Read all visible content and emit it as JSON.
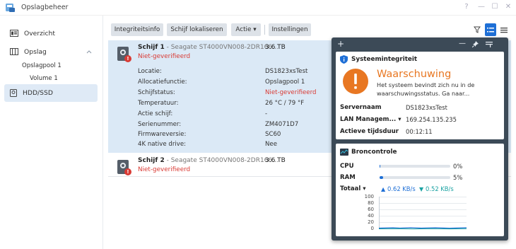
{
  "window": {
    "title": "Opslagbeheer",
    "controls": [
      "?",
      "—",
      "☐",
      "✕"
    ]
  },
  "sidebar": {
    "items": [
      {
        "label": "Overzicht",
        "icon": "overview-icon"
      },
      {
        "label": "Opslag",
        "icon": "storage-icon"
      },
      {
        "label": "HDD/SSD",
        "icon": "hdd-icon"
      }
    ],
    "subitems": [
      "Opslagpool 1",
      "Volume 1"
    ]
  },
  "toolbar": {
    "buttons": [
      "Integriteitsinfo",
      "Schijf lokaliseren",
      "Actie ▾",
      "Instellingen"
    ],
    "icons": [
      "filter-icon",
      "list-view-icon",
      "menu-icon"
    ]
  },
  "disks": [
    {
      "name": "Schijf 1",
      "model": " - Seagate ST4000VN008-2DR166...",
      "size": "3.6 TB",
      "status": "Niet-geverifieerd",
      "details": [
        {
          "label": "Locatie:",
          "value": "DS1823xsTest"
        },
        {
          "label": "Allocatiefunctie:",
          "value": "Opslagpool 1"
        },
        {
          "label": "Schijfstatus:",
          "value": "Niet-geverifieerd"
        },
        {
          "label": "Temperatuur:",
          "value": "26 °C / 79 °F"
        },
        {
          "label": "Actie schijf:",
          "value": "-"
        },
        {
          "label": "Serienummer:",
          "value": "ZM4071D7"
        },
        {
          "label": "Firmwareversie:",
          "value": "SC60"
        },
        {
          "label": "4K native drive:",
          "value": "Nee"
        }
      ]
    },
    {
      "name": "Schijf 2",
      "model": " - Seagate ST4000VN008-2DR166...",
      "size": "3.6 TB",
      "status": "Niet-geverifieerd"
    }
  ],
  "widget": {
    "header_icons": [
      "+",
      "—",
      "pin-icon",
      "settings-icon"
    ],
    "integrity": {
      "title": "Systeemintegriteit",
      "heading": "Waarschuwing",
      "message_line1": "Het systeem bevindt zich nu in de",
      "message_line2": "waarschuwingsstatus. Ga naar...",
      "rows": [
        {
          "key": "Servernaam",
          "value": "DS1823xsTest"
        },
        {
          "key": "LAN Managem... ▾",
          "value": "169.254.135.235"
        },
        {
          "key": "Actieve tijdsduur",
          "value": "00:12:11"
        }
      ]
    },
    "resource": {
      "title": "Broncontrole",
      "cpu_label": "CPU",
      "cpu_value": "0%",
      "cpu_fraction": 0.01,
      "ram_label": "RAM",
      "ram_value": "5%",
      "ram_fraction": 0.05,
      "total_label": "Totaal ▾",
      "upload": "0.62 KB/s",
      "download": "0.52 KB/s",
      "y_ticks": [
        "100",
        "80",
        "60",
        "40",
        "20",
        "0"
      ]
    }
  },
  "colors": {
    "accent": "#1e6fd6",
    "warning": "#e87722",
    "error": "#d93a34",
    "selected_row": "#dbe9f6",
    "widget_bg": "#3c4a57"
  }
}
